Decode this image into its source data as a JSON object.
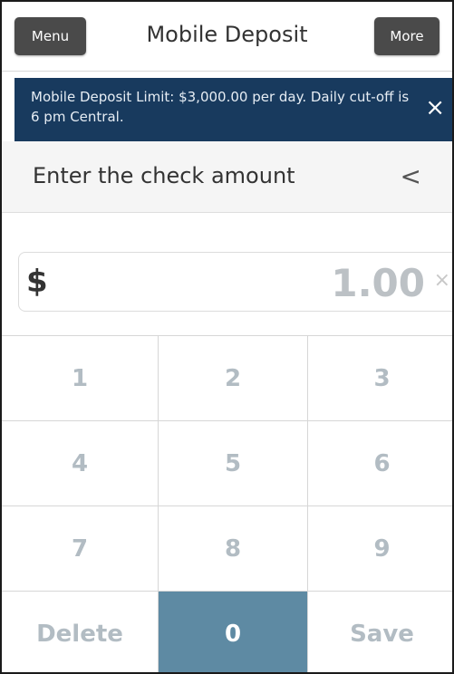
{
  "header": {
    "menu_label": "Menu",
    "title": "Mobile Deposit",
    "more_label": "More"
  },
  "banner": {
    "text": "Mobile Deposit Limit: $3,000.00 per day. Daily cut-off is 6 pm Central.",
    "close_icon": "close-icon"
  },
  "section": {
    "title": "Enter the check amount",
    "back_icon": "chevron-left-icon"
  },
  "amount": {
    "currency_symbol": "$",
    "value": "1.00",
    "clear_icon": "clear-icon"
  },
  "keypad": {
    "keys": [
      "1",
      "2",
      "3",
      "4",
      "5",
      "6",
      "7",
      "8",
      "9"
    ],
    "delete_label": "Delete",
    "zero_label": "0",
    "save_label": "Save"
  },
  "colors": {
    "banner_bg": "#183a5e",
    "active_key_bg": "#5e8aa3",
    "button_bg": "#4a4a4a"
  }
}
